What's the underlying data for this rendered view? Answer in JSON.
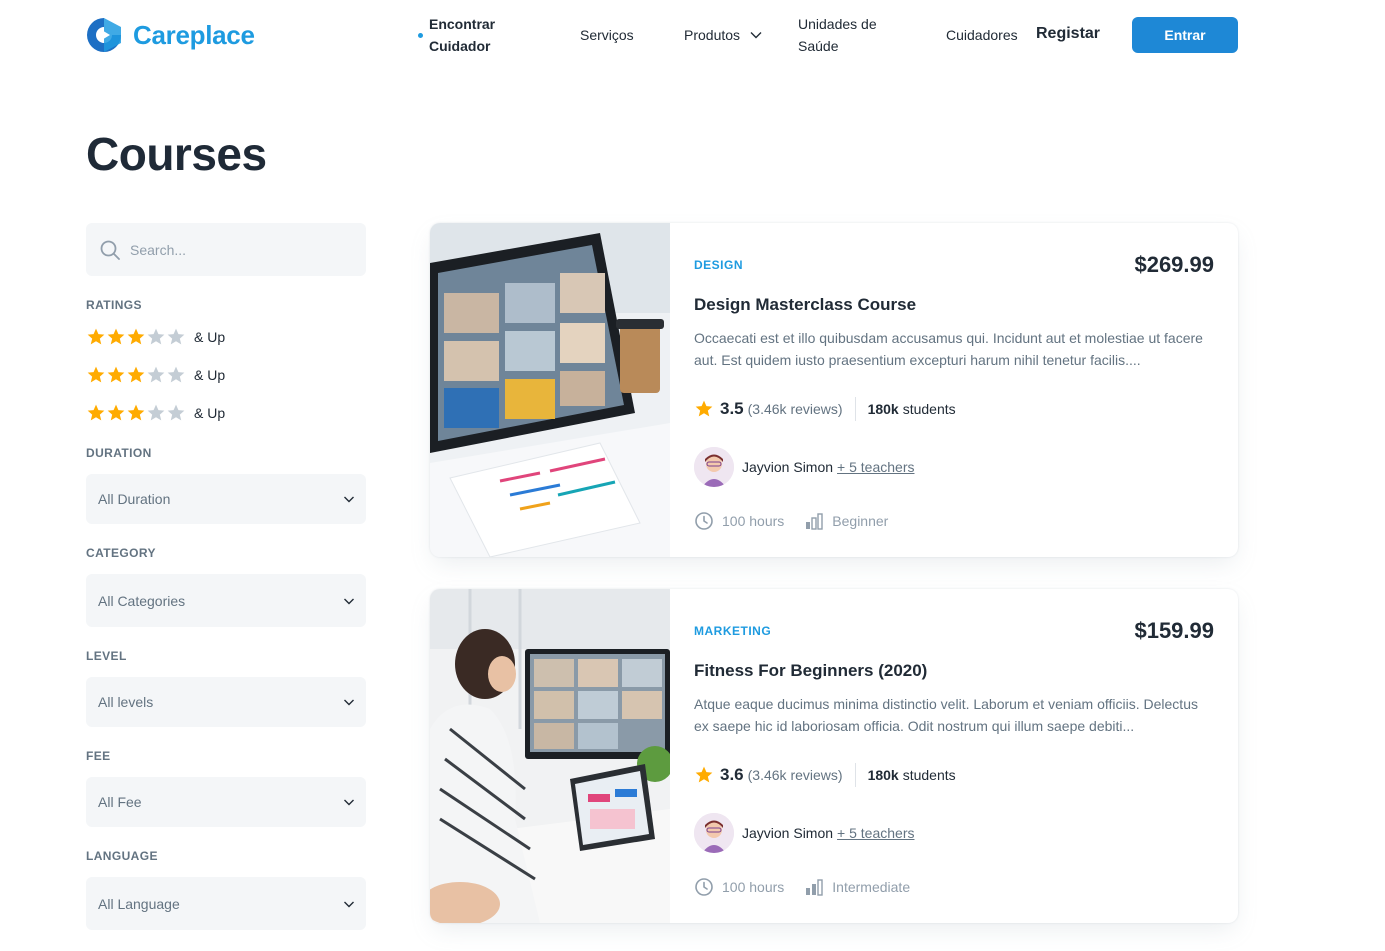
{
  "header": {
    "brand": "Careplace",
    "nav": {
      "encontrar": "Encontrar\nCuidador",
      "servicos": "Serviços",
      "produtos": "Produtos",
      "unidades": "Unidades de\nSaúde",
      "cuidadores": "Cuidadores",
      "registar": "Registar"
    },
    "login_button": "Entrar"
  },
  "page_title": "Courses",
  "filters": {
    "search_placeholder": "Search...",
    "ratings_label": "RATINGS",
    "ratings": [
      {
        "stars": 3,
        "suffix": "& Up"
      },
      {
        "stars": 3,
        "suffix": "& Up"
      },
      {
        "stars": 3,
        "suffix": "& Up"
      }
    ],
    "duration_label": "DURATION",
    "duration_value": "All Duration",
    "category_label": "CATEGORY",
    "category_value": "All Categories",
    "level_label": "LEVEL",
    "level_value": "All levels",
    "fee_label": "FEE",
    "fee_value": "All Fee",
    "language_label": "LANGUAGE",
    "language_value": "All Language"
  },
  "courses": [
    {
      "category": "DESIGN",
      "price": "$269.99",
      "title": "Design Masterclass Course",
      "description": "Occaecati est et illo quibusdam accusamus qui. Incidunt aut et molestiae ut facere aut. Est quidem iusto praesentium excepturi harum nihil tenetur facilis....",
      "rating": "3.5",
      "reviews": "(3.46k reviews)",
      "students_count": "180k",
      "students_label": "students",
      "teacher": "Jayvion Simon",
      "more_teachers": "+ 5 teachers",
      "hours": "100 hours",
      "level": "Beginner"
    },
    {
      "category": "MARKETING",
      "price": "$159.99",
      "title": "Fitness For Beginners (2020)",
      "description": "Atque eaque ducimus minima distinctio velit. Laborum et veniam officiis. Delectus ex saepe hic id laboriosam officia. Odit nostrum qui illum saepe debiti...",
      "rating": "3.6",
      "reviews": "(3.46k reviews)",
      "students_count": "180k",
      "students_label": "students",
      "teacher": "Jayvion Simon",
      "more_teachers": "+ 5 teachers",
      "hours": "100 hours",
      "level": "Intermediate"
    }
  ],
  "colors": {
    "accent": "#1e9be0",
    "button": "#1e88d6",
    "star": "#ffab00",
    "star_empty": "#c4cdd5"
  }
}
